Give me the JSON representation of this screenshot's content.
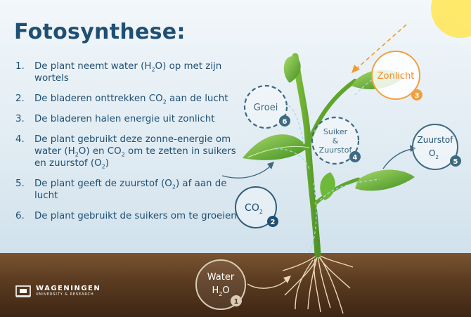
{
  "title": "Fotosynthese:",
  "steps": [
    {
      "num": "1.",
      "parts": [
        "De plant neemt water (H",
        "2",
        "O) op met zijn wortels"
      ]
    },
    {
      "num": "2.",
      "parts": [
        "De bladeren onttrekken CO",
        "2",
        " aan de lucht"
      ]
    },
    {
      "num": "3.",
      "parts": [
        "De bladeren halen energie uit zonlicht"
      ]
    },
    {
      "num": "4.",
      "parts": [
        "De plant gebruikt deze zonne-energie om water (H",
        "2",
        "O) en CO",
        "2",
        " om te zetten in suikers en zuurstof (O",
        "2",
        ")"
      ]
    },
    {
      "num": "5.",
      "parts": [
        "De plant geeft de zuurstof (O",
        "2",
        ") af aan de lucht"
      ]
    },
    {
      "num": "6.",
      "parts": [
        "De plant gebruikt de suikers om te groeien"
      ]
    }
  ],
  "diagram": {
    "water": {
      "label": "Water",
      "formula_main": "H",
      "formula_sub": "2",
      "formula_end": "O",
      "badge": "1"
    },
    "co2": {
      "label": "CO",
      "sub": "2",
      "badge": "2"
    },
    "sun": {
      "label": "Zonlicht",
      "badge": "3"
    },
    "sugar": {
      "line1": "Suiker",
      "line2": "&",
      "line3": "Zuurstof",
      "badge": "4"
    },
    "oxygen": {
      "label": "Zuurstof",
      "formula_main": "O",
      "formula_sub": "2",
      "badge": "5"
    },
    "growth": {
      "label": "Groei",
      "badge": "6"
    }
  },
  "logo": {
    "name": "WAGENINGEN",
    "subtitle": "UNIVERSITY & RESEARCH"
  },
  "colors": {
    "navy": "#1f4f73",
    "teal": "#3d6a82",
    "orange": "#f0a040",
    "leaf": "#5fae2e",
    "soil": "#5d3d22"
  }
}
